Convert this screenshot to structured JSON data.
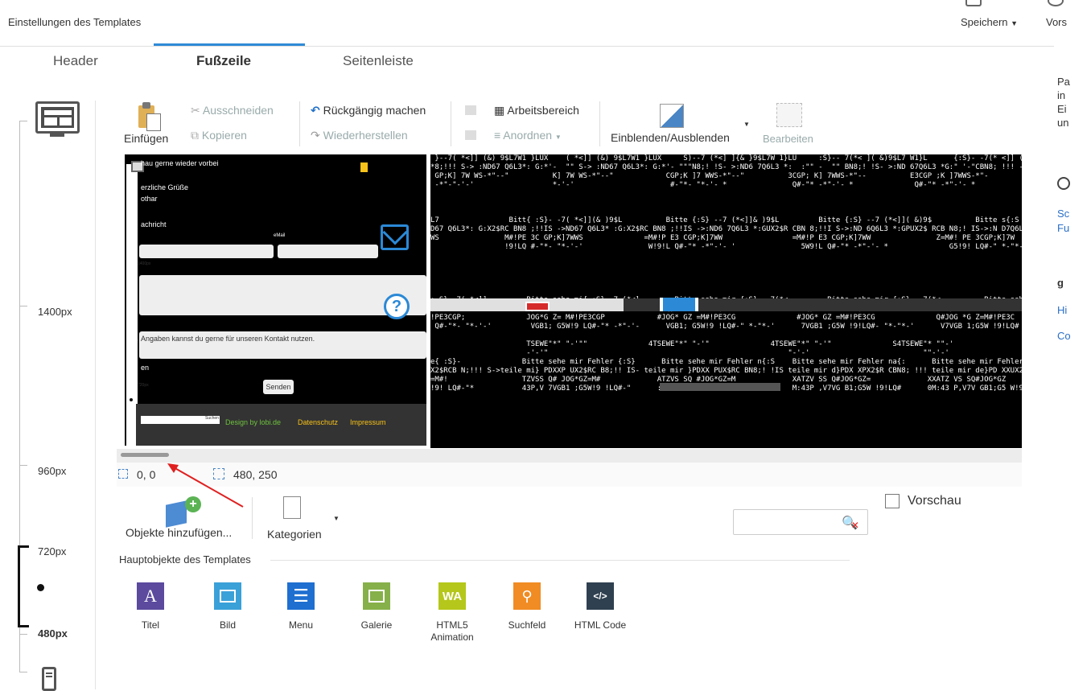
{
  "header": {
    "subtitle": "Einstellungen des Templates",
    "save_label": "Speichern",
    "preview_label": "Vors"
  },
  "tabs": [
    {
      "label": "Header",
      "active": false
    },
    {
      "label": "Fußzeile",
      "active": true
    },
    {
      "label": "Seitenleiste",
      "active": false
    }
  ],
  "ruler": {
    "labels": [
      "1400px",
      "960px",
      "720px",
      "480px"
    ]
  },
  "ribbon": {
    "paste": "Einfügen",
    "cut": "Ausschneiden",
    "copy": "Kopieren",
    "undo": "Rückgängig machen",
    "redo": "Wiederherstellen",
    "workspace": "Arbeitsbereich",
    "arrange": "Anordnen",
    "toggle": "Einblenden/Ausblenden",
    "edit": "Bearbeiten"
  },
  "preview": {
    "text1": "hau gerne wieder vorbei",
    "text2": "erzliche Grüße",
    "text3": "othar",
    "text4": "achricht",
    "email_label": "eMail",
    "info_text": "Angaben kannst du gerne für unseren Kontakt nutzen.",
    "en": "en",
    "send": "Senden",
    "search_btn": "Suchen",
    "design": "Design by lobi.de",
    "privacy": "Datenschutz",
    "imprint": "Impressum",
    "rl1400": "1400px",
    "rl960": "960px",
    "rl720": "720px",
    "rl480": "480px"
  },
  "garbled_lines": [
    " }--7( *<]] (&) 9$L7W1 }LUX    ( *<]] (&) 9$L7W1 }LUX     S)--7 (*<] ]{& }9$L7W 1}LU     :S}-- 7(*< ]( &)9$L7 W1}L      {:S}- -7(* <]] (&)9$L 7W1}        {:S}- -7(* <]] (",
    "*8;!!! S-> :ND67 Q6L3*: G:*'-  \"\" S-> :ND67 Q6L3*: G:*'- \"\"\"N8;! !S- >:ND6 7Q6L3 *:  :\"\" -  \"\" BN8;! !S- >:ND 67Q6L3 *G:\" '-\"CBN8; !!! ->:ND 67Q6L3 *:G:\" \"-CBN8; !!! S->",
    " GP;K] 7W WS-*\"--\"          K] 7W WS-*\"--\"            CGP;K ]7 WWS-*\"--\"          3CGP; K] 7WWS-*\"--          E3CGP ;K ]7WWS-*\"-          E3CGP ;K ]7W",
    " -*\"-\"-'-'                  *-'-'                      #-\"*- \"*-'- *               Q#-\"* -*\"-'- *              Q#-\"* -*\"-'- *               LQ#-\" *-\"*-'-",
    "",
    "",
    "",
    "L7                Bitt{ :S}- -7( *<]](& )9$L          Bitte {:S} --7 (*<]]& )9$L         Bitte {:S} --7 (*<]]( &)9$          Bitte s{:S }-- 7(*<]] (&)9          Bitte se{: S",
    "D67 Q6L3*: G:X2$RC BN8 ;!!IS ->ND67 Q6L3* :G:X2$RC BN8 ;!!IS ->:ND6 7Q6L3 *:GUX2$R CBN 8;!!I S->:ND 6Q6L3 *:GPUX2$ RCB N8;! IS->:N D7Q6L 3*:XPUX2 $R",
    "WS               M#!PE 3C GP;K]7WWS              =M#!P E3 CGP;K]7WW                =M#!P E3 CGP;K]7WW               Z=M#! PE 3CGP;K]7W               GZ=M# !P",
    "                 !9!LQ #-\"*- \"*-'-'               W!9!L Q#-\"* -*\"-'- '               5W9!L Q#-\"* -*\"-'- *              G5!9! LQ#-\" *-\"*-'-'              ;GW!9 !LQ",
    "",
    "",
    "",
    "",
    "",
    ": S}--7( *<]]         Bitte sehe mi{ :S}--7 (*<]        Bitte sehe mir {:S}-- 7(*<         Bitte sehe mir {:S}-- 7(*<          Bitte sehe mir F{:S}- -7(*",
    "$RCBN 8;!!IS -:ND6 7Q6 }PDXX PUX 2$RCB N8;!! S>:ND 67Q{}PDX XPU X2$CB N8;!! S->:N D67 {}PDX XPU X2$RC BN8;! I->:N D67te}PD XXP UX2$R CBN8;! IS->",
    "!PE3CGP;              JOG*G Z= M#!PE3CGP            #JOG* GZ =M#!PE3CG              #JOG* GZ =M#!PE3CG              Q#JOG *G Z=M#!PE3C",
    " Q#-\"*- \"*-'-'         VGB1; G5W!9 LQ#-\"* -*\"-'-      VGB1; G5W!9 !LQ#-\" *-\"*-'      7VGB1 ;G5W !9!LQ#- \"*-\"*-'      V7VGB 1;G5W !9!LQ# -\"*\"-",
    "",
    "                      TSEWE\"*\" \"-'\"\"              4TSEWE\"*\" \"-'\"              4TSEWE\"*\" \"-'\"              S4TSEWE\"* \"\"-'",
    "                      -'-'\"                                                       \"-'-'                          \"\"-'-'",
    "e{ :S}-              Bitte sehe mir Fehler {:S}      Bitte sehe mir Fehler n{:S    Bitte sehe mir Fehler na{:      Bitte sehe mir Fehler nac{       Bitte sehe m",
    "X2$RCB N;!!! S->teile mi} PDXXP UX2$RC B8;!! IS- teile mir }PDXX PUX$RC BN8;! !IS teile mir d}PDX XPX2$R CBN8; !!! teile mir de}PD XXUX2$ RCBN8 ;!!teile mir de}",
    "=M#!                 TZVSS Q# JOG*GZ=M#             ATZVS SQ #JOG*GZ=M             XATZV SS Q#JOG*GZ=             XXATZ VS SQ#JOG*GZ             4XATZ VS S",
    "!9! LQ#-\"*           43P,V 7VGB1 ;G5W!9 !LQ#-\"      :43P, V7VGB 1;G5W! 9!LQ#-      M:43P ,V7VG B1;G5W !9!LQ#      0M:43 P,V7V GB1;G5 W!9!LQ      B0M:4 3P,V"
  ],
  "status": {
    "position": "0, 0",
    "size": "480, 250"
  },
  "objects_toolbar": {
    "add_objects": "Objekte hinzufügen...",
    "categories": "Kategorien",
    "preview_checkbox": "Vorschau"
  },
  "objects_section": {
    "title": "Hauptobjekte des Templates",
    "items": [
      {
        "label": "Titel",
        "icon": "A",
        "color": "#5b4a9e"
      },
      {
        "label": "Bild",
        "icon": "image",
        "color": "#3aa0d8"
      },
      {
        "label": "Menu",
        "icon": "menu",
        "color": "#1e6fd0"
      },
      {
        "label": "Galerie",
        "icon": "gallery",
        "color": "#86b04a"
      },
      {
        "label": "HTML5 Animation",
        "icon": "WA",
        "color": "#b5c71a"
      },
      {
        "label": "Suchfeld",
        "icon": "search",
        "color": "#f08c23"
      },
      {
        "label": "HTML Code",
        "icon": "</>",
        "color": "#2f4050"
      }
    ]
  },
  "right_panel": {
    "lines": [
      "Pa",
      "in",
      "Ei",
      "un"
    ],
    "links": [
      "Sc",
      "Fu"
    ],
    "g_label": "g",
    "links2": [
      "Hi",
      "Co"
    ]
  }
}
